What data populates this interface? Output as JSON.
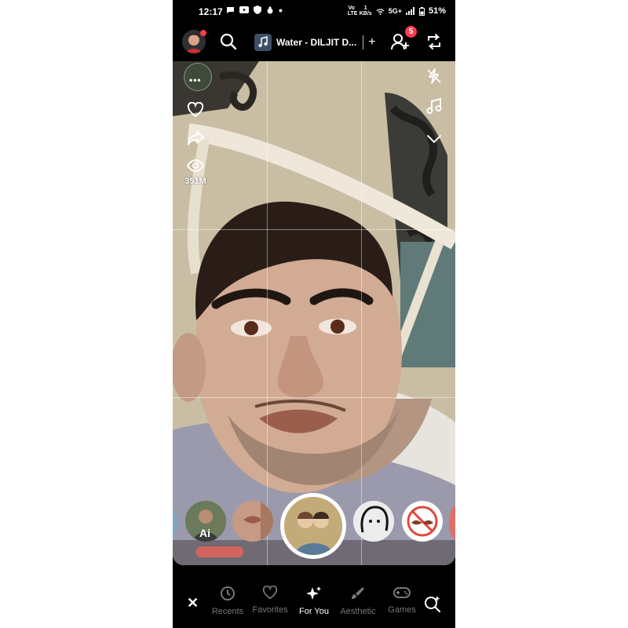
{
  "status_bar": {
    "time": "12:17",
    "network_speed_top": "1",
    "network_speed_unit": "KB/s",
    "network_type": "5G+",
    "battery": "51%",
    "volte_label": "Vo LTE"
  },
  "top_bar": {
    "song_title": "Water - DILJIT D...",
    "song_add": "+",
    "friend_requests_badge": "5"
  },
  "side_left": {
    "views_count": "351M"
  },
  "bottom_tabs": {
    "close": "✕",
    "tabs": [
      {
        "label": "Recents",
        "icon": "history-icon",
        "active": false
      },
      {
        "label": "Favorites",
        "icon": "heart-icon",
        "active": false
      },
      {
        "label": "For You",
        "icon": "sparkles-icon",
        "active": true
      },
      {
        "label": "Aesthetic",
        "icon": "brush-icon",
        "active": false
      },
      {
        "label": "Games",
        "icon": "gamepad-icon",
        "active": false
      }
    ]
  },
  "colors": {
    "badge": "#ff3b4d",
    "active_tab": "#ffffff",
    "inactive_tab": "#777777",
    "background": "#000000"
  }
}
